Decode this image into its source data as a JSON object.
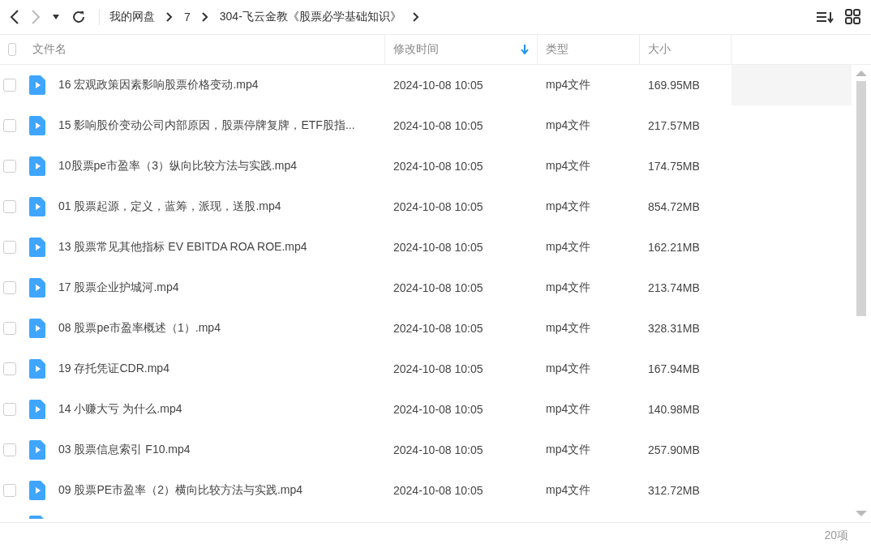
{
  "breadcrumb": [
    "我的网盘",
    "7",
    "304-飞云金教《股票必学基础知识》"
  ],
  "select_all_checked": false,
  "columns": [
    {
      "label": "文件名",
      "sorted": false
    },
    {
      "label": "修改时间",
      "sorted": true
    },
    {
      "label": "类型",
      "sorted": false
    },
    {
      "label": "大小",
      "sorted": false
    }
  ],
  "rows": [
    {
      "name": "16 宏观政策因素影响股票价格变动.mp4",
      "modified": "2024-10-08 10:05",
      "type": "mp4文件",
      "size": "169.95MB",
      "checked": false,
      "hovered": true
    },
    {
      "name": "15 影响股价变动公司内部原因，股票停牌复牌，ETF股指...",
      "modified": "2024-10-08 10:05",
      "type": "mp4文件",
      "size": "217.57MB",
      "checked": false,
      "hovered": false
    },
    {
      "name": "10股票pe市盈率（3）纵向比较方法与实践.mp4",
      "modified": "2024-10-08 10:05",
      "type": "mp4文件",
      "size": "174.75MB",
      "checked": false,
      "hovered": false
    },
    {
      "name": "01 股票起源，定义，蓝筹，派现，送股.mp4",
      "modified": "2024-10-08 10:05",
      "type": "mp4文件",
      "size": "854.72MB",
      "checked": false,
      "hovered": false
    },
    {
      "name": "13 股票常见其他指标 EV EBITDA ROA ROE.mp4",
      "modified": "2024-10-08 10:05",
      "type": "mp4文件",
      "size": "162.21MB",
      "checked": false,
      "hovered": false
    },
    {
      "name": "17 股票企业护城河.mp4",
      "modified": "2024-10-08 10:05",
      "type": "mp4文件",
      "size": "213.74MB",
      "checked": false,
      "hovered": false
    },
    {
      "name": "08 股票pe市盈率概述（1）.mp4",
      "modified": "2024-10-08 10:05",
      "type": "mp4文件",
      "size": "328.31MB",
      "checked": false,
      "hovered": false
    },
    {
      "name": "19 存托凭证CDR.mp4",
      "modified": "2024-10-08 10:05",
      "type": "mp4文件",
      "size": "167.94MB",
      "checked": false,
      "hovered": false
    },
    {
      "name": "14 小赚大亏 为什么.mp4",
      "modified": "2024-10-08 10:05",
      "type": "mp4文件",
      "size": "140.98MB",
      "checked": false,
      "hovered": false
    },
    {
      "name": "03 股票信息索引 F10.mp4",
      "modified": "2024-10-08 10:05",
      "type": "mp4文件",
      "size": "257.90MB",
      "checked": false,
      "hovered": false
    },
    {
      "name": "09 股票PE市盈率（2）横向比较方法与实践.mp4",
      "modified": "2024-10-08 10:05",
      "type": "mp4文件",
      "size": "312.72MB",
      "checked": false,
      "hovered": false
    }
  ],
  "status_bar": {
    "count": "20项"
  }
}
